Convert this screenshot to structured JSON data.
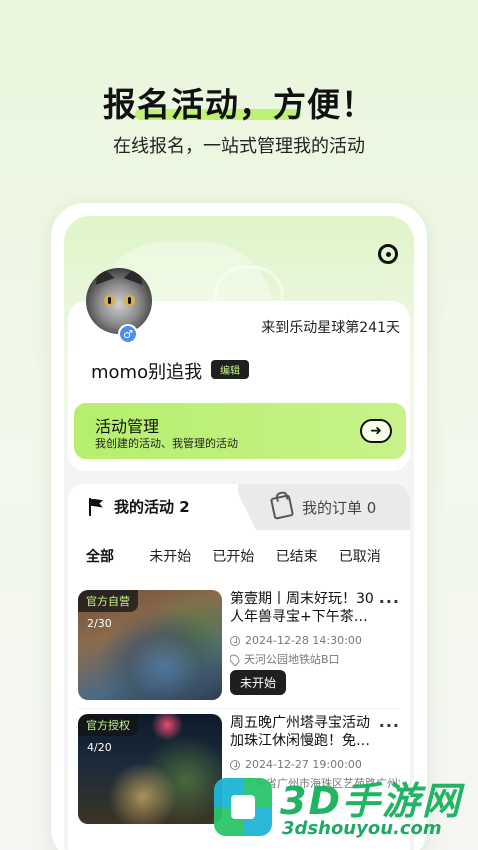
{
  "promo": {
    "headline": "报名活动，方便！",
    "subhead": "在线报名，一站式管理我的活动"
  },
  "profile": {
    "days_text": "来到乐动星球第241天",
    "username": "momo别追我",
    "edit_label": "编辑",
    "gender_symbol": "♂"
  },
  "manage_card": {
    "title": "活动管理",
    "subtitle": "我创建的活动、我管理的活动",
    "arrow": "➜"
  },
  "tabs": [
    {
      "label": "我的活动 2",
      "active": true
    },
    {
      "label": "我的订单 0",
      "active": false
    }
  ],
  "filters": [
    "全部",
    "未开始",
    "已开始",
    "已结束",
    "已取消"
  ],
  "activities": [
    {
      "tag": "官方自营",
      "count": "2/30",
      "title": "第壹期丨周末好玩！30人年兽寻宝+下午茶…",
      "time": "2024-12-28 14:30:00",
      "location": "天河公园地铁站B口",
      "status": "未开始",
      "more": "···"
    },
    {
      "tag": "官方授权",
      "count": "4/20",
      "title": "周五晚广州塔寻宝活动加珠江休闲慢跑！免…",
      "time": "2024-12-27 19:00:00",
      "location": "广东省广州市海珠区艺苑路广州塔",
      "more": "···"
    }
  ],
  "watermark": {
    "title": "3D手游网",
    "url": "3dshouyou.com"
  },
  "colors": {
    "accent_green": "#b5ef6d",
    "dark": "#1f1f1f"
  },
  "icons": [
    "settings-icon",
    "flag-icon",
    "bag-icon",
    "clock-icon",
    "pin-icon",
    "arrow-right-icon",
    "more-icon"
  ]
}
